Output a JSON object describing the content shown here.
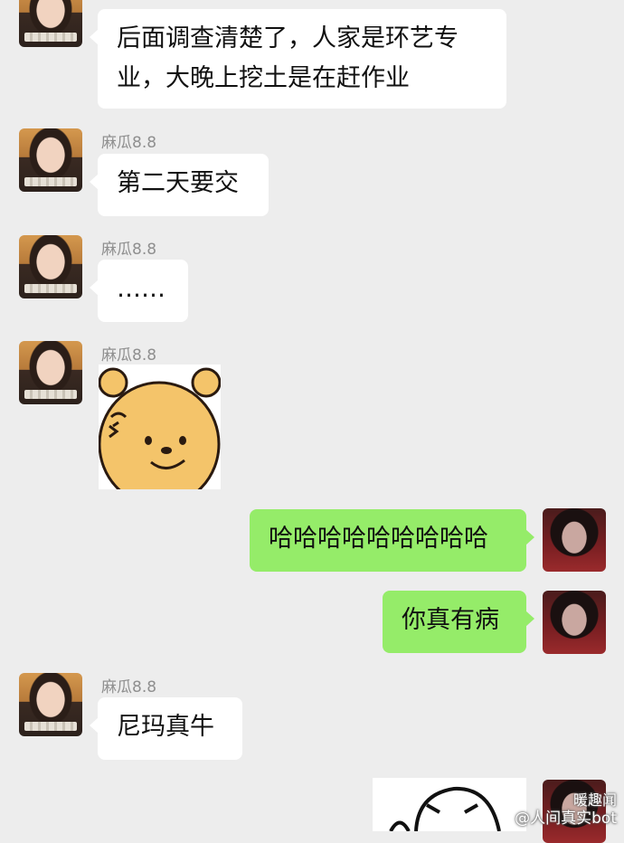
{
  "messages": [
    {
      "text_line1": "后面调查清楚了，人家是环艺专",
      "text_line2": "业，大晚上挖土是在赶作业"
    },
    {
      "sender": "麻瓜8.8",
      "text": "第二天要交"
    },
    {
      "sender": "麻瓜8.8",
      "text": "……"
    },
    {
      "sender": "麻瓜8.8",
      "sticker": "winnie-the-pooh-face-sticker"
    },
    {
      "text": "哈哈哈哈哈哈哈哈哈"
    },
    {
      "text": "你真有病"
    },
    {
      "sender": "麻瓜8.8",
      "text": "尼玛真牛"
    }
  ],
  "watermark": {
    "line1": "暖趣闻",
    "line2": "@人间真实bot"
  },
  "colors": {
    "background": "#ededed",
    "incoming": "#ffffff",
    "outgoing": "#95ec69"
  }
}
